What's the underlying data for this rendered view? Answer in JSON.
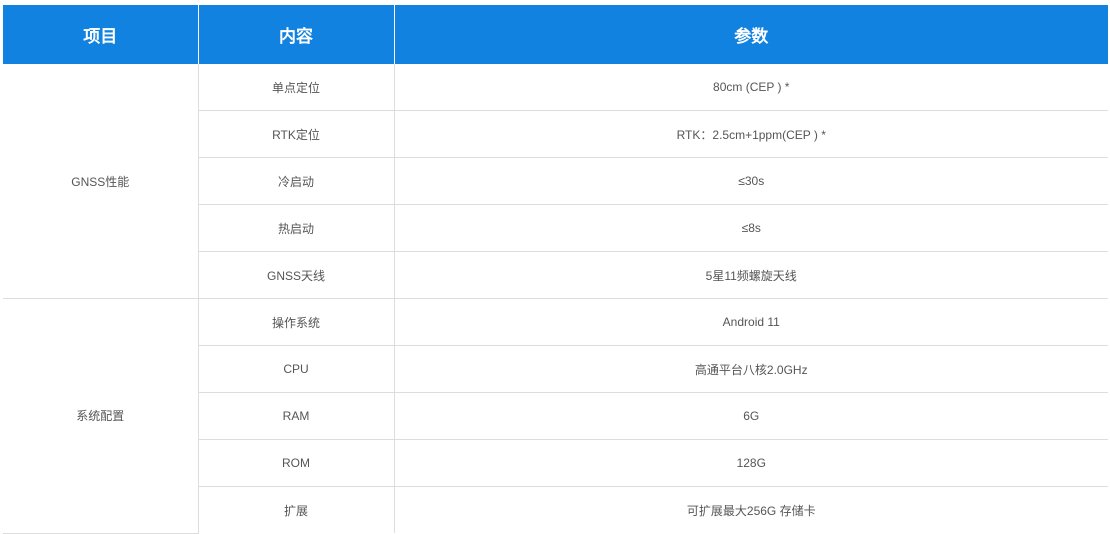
{
  "table": {
    "headers": [
      "项目",
      "内容",
      "参数"
    ],
    "groups": [
      {
        "name": "GNSS性能",
        "rows": [
          {
            "item": "单点定位",
            "value": "80cm (CEP ) *"
          },
          {
            "item": "RTK定位",
            "value": "RTK：2.5cm+1ppm(CEP ) *"
          },
          {
            "item": "冷启动",
            "value": "≤30s"
          },
          {
            "item": "热启动",
            "value": "≤8s"
          },
          {
            "item": "GNSS天线",
            "value": "5星11频螺旋天线"
          }
        ]
      },
      {
        "name": "系统配置",
        "rows": [
          {
            "item": "操作系统",
            "value": "Android 11"
          },
          {
            "item": "CPU",
            "value": "高通平台八核2.0GHz"
          },
          {
            "item": "RAM",
            "value": "6G"
          },
          {
            "item": "ROM",
            "value": "128G"
          },
          {
            "item": "扩展",
            "value": "可扩展最大256G 存储卡"
          }
        ]
      }
    ]
  },
  "colors": {
    "header_bg": "#1282e0",
    "header_text": "#ffffff",
    "border": "#dddddd",
    "cell_text": "#555555"
  }
}
